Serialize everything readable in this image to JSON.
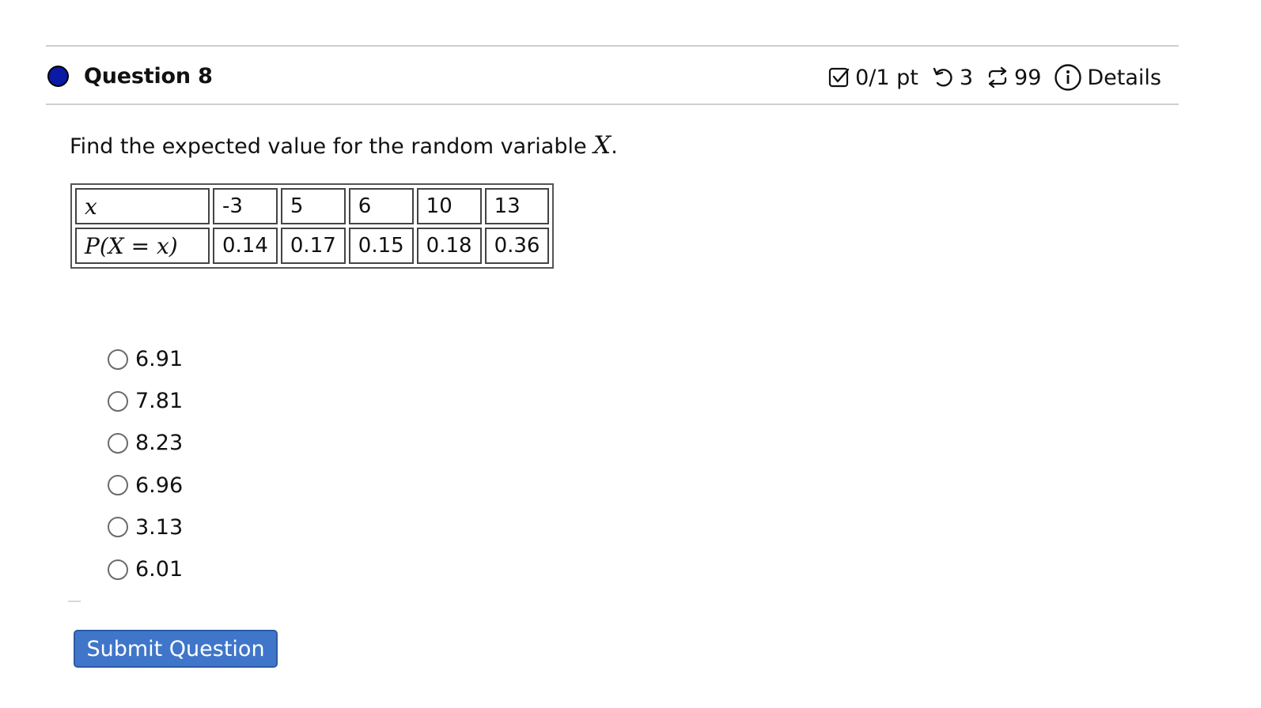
{
  "question": {
    "title": "Question 8",
    "status_dot_color": "#0a1aa6",
    "score": "0/1 pt",
    "retries": "3",
    "attempts": "99",
    "details_label": "Details"
  },
  "prompt": {
    "text": "Find the expected value for the random variable ",
    "variable": "X",
    "end": "."
  },
  "table": {
    "row1_label": "x",
    "row2_label": "P(X = x)",
    "x_values": [
      "-3",
      "5",
      "6",
      "10",
      "13"
    ],
    "p_values": [
      "0.14",
      "0.17",
      "0.15",
      "0.18",
      "0.36"
    ]
  },
  "options": [
    "6.91",
    "7.81",
    "8.23",
    "6.96",
    "3.13",
    "6.01"
  ],
  "submit_label": "Submit Question",
  "colors": {
    "accent": "#3f76c9",
    "rule": "#cfcfcf"
  },
  "icons": {
    "score": "checkbox-icon",
    "retries": "undo-icon",
    "attempts": "repeat-icon",
    "details": "info-icon"
  }
}
